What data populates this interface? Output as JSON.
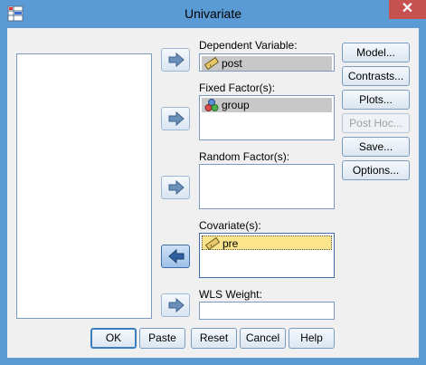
{
  "window": {
    "title": "Univariate",
    "close_glyph": "✕"
  },
  "fields": {
    "dependent": {
      "label": "Dependent Variable:",
      "value": "post",
      "icon": "ruler-icon"
    },
    "fixed": {
      "label": "Fixed Factor(s):",
      "items": [
        "group"
      ],
      "icon": "nominal-circles-icon"
    },
    "random": {
      "label": "Random Factor(s):",
      "items": []
    },
    "covariate": {
      "label": "Covariate(s):",
      "items": [
        "pre"
      ],
      "icon": "ruler-icon"
    },
    "wls": {
      "label": "WLS Weight:",
      "value": ""
    }
  },
  "side_buttons": {
    "model": "Model...",
    "contrasts": "Contrasts...",
    "plots": "Plots...",
    "post_hoc": "Post Hoc...",
    "save": "Save...",
    "options": "Options..."
  },
  "bottom_buttons": {
    "ok": "OK",
    "paste": "Paste",
    "reset": "Reset",
    "cancel": "Cancel",
    "help": "Help"
  },
  "colors": {
    "frame": "#5b9bd5",
    "selected_item": "#fae48c",
    "item_gray": "#c8c8c8"
  }
}
